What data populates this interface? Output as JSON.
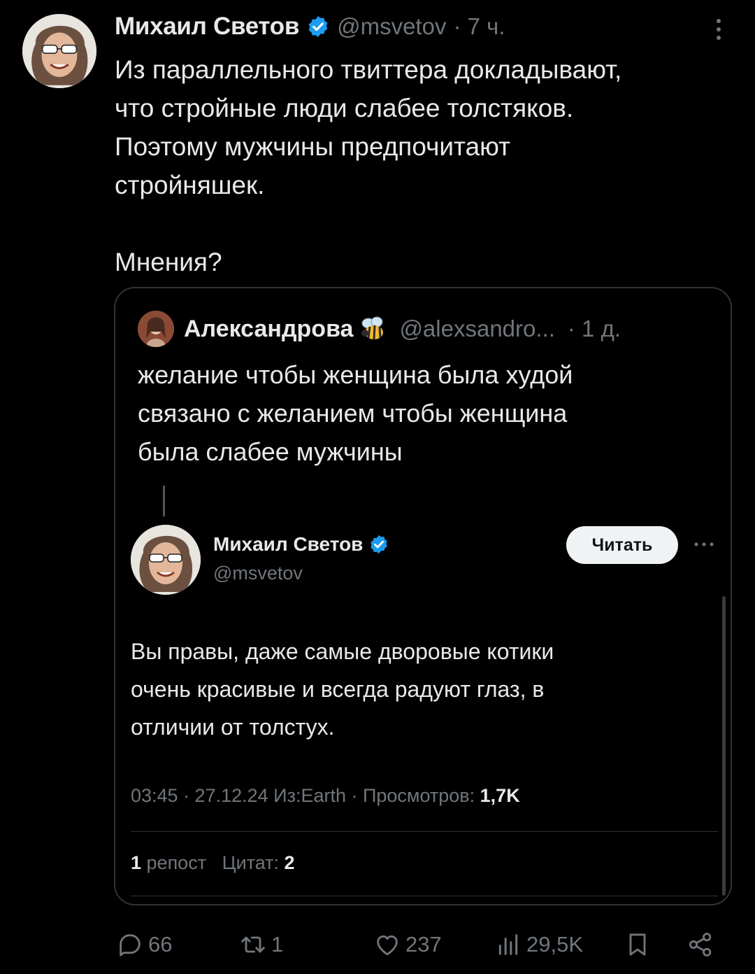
{
  "tweet": {
    "author_name": "Михаил Светов",
    "handle": "@msvetov",
    "time": "· 7 ч.",
    "lines": [
      "Из параллельного твиттера докладывают,",
      "что стройные люди слабее толстяков.",
      "Поэтому мужчины предпочитают",
      "стройняшек."
    ],
    "closing_line": "Мнения?"
  },
  "quoted": {
    "author_name": "Александрова",
    "handle": "@alexsandro...",
    "time": "· 1 д.",
    "lines": [
      "желание чтобы женщина была худой",
      "связано с желанием чтобы женщина",
      "была слабее мужчины"
    ]
  },
  "embedded": {
    "author_name": "Михаил Светов",
    "handle": "@msvetov",
    "follow_label": "Читать",
    "lines": [
      "Вы правы, даже самые дворовые котики",
      "очень красивые и всегда радуют глаз, в",
      "отличии от толстух."
    ],
    "meta_prefix": "03:45 · 27.12.24 Из:Earth · Просмотров: ",
    "views": "1,7K",
    "reposts_count": "1",
    "reposts_label": " репост",
    "quotes_label": "Цитат: ",
    "quotes_count": "2"
  },
  "actions": {
    "replies": "66",
    "reposts": "1",
    "likes": "237",
    "views": "29,5K"
  },
  "colors": {
    "background": "#000000",
    "text": "#e7e9ea",
    "muted": "#71767b",
    "border": "#2f3336",
    "verified": "#1d9bf0"
  },
  "icons": [
    "verified-badge-icon",
    "bee-icon",
    "more-dots-icon",
    "reply-icon",
    "repost-icon",
    "like-icon",
    "views-icon",
    "bookmark-icon",
    "share-icon"
  ]
}
